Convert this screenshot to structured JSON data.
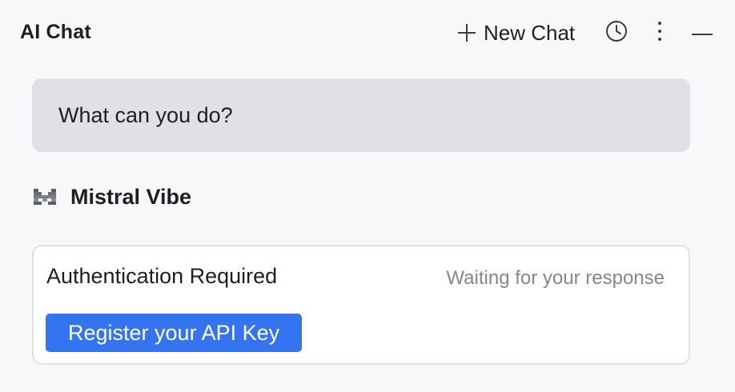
{
  "header": {
    "title": "AI Chat",
    "new_chat_label": "New Chat",
    "icons": [
      "plus-icon",
      "history-icon",
      "more-vertical-icon",
      "minimize-icon"
    ]
  },
  "conversation": {
    "user_message": "What can you do?",
    "agent": {
      "name": "Mistral Vibe",
      "logo": "mistral-logo-icon"
    },
    "auth_card": {
      "title": "Authentication Required",
      "status": "Waiting for your response",
      "button_label": "Register your API Key"
    }
  },
  "colors": {
    "background": "#f7f8fa",
    "user_bubble": "#dfe1e5",
    "card_border": "#dfe1e5",
    "primary_button": "#3574f0",
    "muted_text": "#818594"
  }
}
